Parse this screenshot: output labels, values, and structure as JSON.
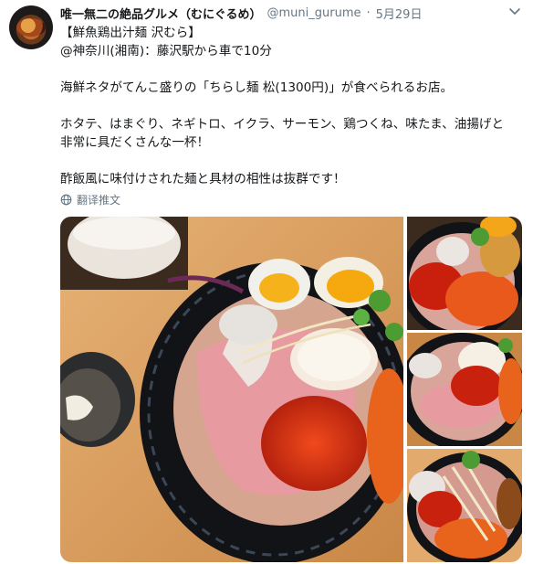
{
  "tweet": {
    "display_name": "唯一無二の絶品グルメ（むにぐるめ）",
    "handle": "@muni_gurume",
    "separator": "·",
    "date": "5月29日",
    "lines": [
      "【鮮魚鶏出汁麺 沢むら】",
      "@神奈川(湘南)：藤沢駅から車で10分",
      "",
      "海鮮ネタがてんこ盛りの「ちらし麺 松(1300円)」が食べられるお店。",
      "",
      "ホタテ、はまぐり、ネギトロ、イクラ、サーモン、鶏つくね、味たま、油揚げと",
      "非常に具だくさんな一杯！",
      "",
      "酢飯風に味付けされた麺と具材の相性は抜群です！"
    ],
    "translate_label": "翻译推文"
  },
  "icons": {
    "avatar": "restaurant-dish-avatar",
    "menu": "chevron-down-icon",
    "translate": "globe-icon"
  },
  "colors": {
    "text": "#14171a",
    "secondary": "#657786",
    "background": "#ffffff"
  }
}
